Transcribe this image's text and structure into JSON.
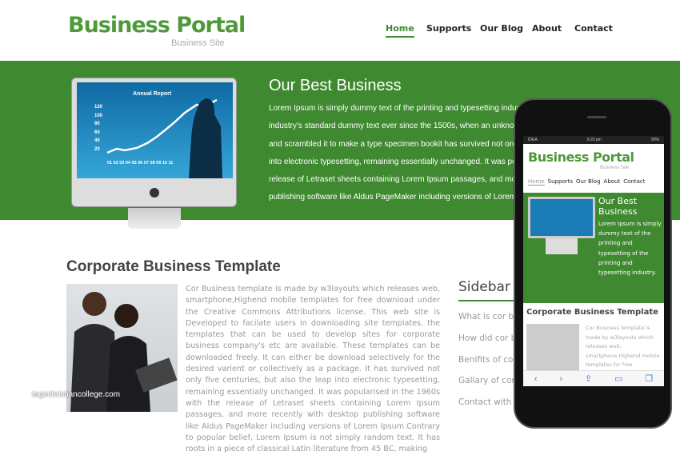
{
  "header": {
    "logo": "Business Portal",
    "tagline": "Business Site",
    "nav": [
      {
        "label": "Home",
        "active": true
      },
      {
        "label": "Supports"
      },
      {
        "label": "Our Blog"
      },
      {
        "label": "About"
      },
      {
        "label": "Contact"
      }
    ]
  },
  "hero": {
    "title": "Our Best Business",
    "lines": [
      "Lorem Ipsum is simply dummy text of the printing and typesetting industry",
      "industry's standard dummy text ever since the 1500s, when an unknown",
      "and scrambled it to make a type specimen bookit has survived not only f",
      "into electronic typesetting, remaining essentially unchanged. It was popu",
      "release of Letraset sheets containing Lorem Ipsum passages, and more",
      "publishing software like Aldus PageMaker including versions of Lorem Ip"
    ],
    "monitor": {
      "title": "Annual Report",
      "yticks": [
        "120",
        "100",
        "80",
        "60",
        "40",
        "20"
      ],
      "xticks": "01 02 03 04 05 06 07 08 09 10 11"
    }
  },
  "main": {
    "title": "Corporate Business Template",
    "paragraph": "Cor Business template is made by w3layouts which releases web, smartphone,Highend mobile templates for free download under the Creative Commons Attributions license. This web site is Developed to facilate users in downloading site templates, the templates that can be used to develop sites for corporate business company's etc are available. These templates can be downloaded freely. It can either be download selectively for the desired varient or collectively as a package. It has survived not only five centuries, but also the leap into electronic typesetting, remaining essentially unchanged. It was popularised in the 1960s with the release of Letraset sheets containing Lorem Ipsum passages, and more recently with desktop publishing software like Aldus PageMaker including versions of Lorem Ipsum.Contrary to popular belief, Lorem Ipsum is not simply random text. It has roots in a piece of classical Latin literature from 45 BC, making"
  },
  "sidebar": {
    "title": "Sidebar M",
    "items": [
      "What is cor bu",
      "How did cor be",
      "Benifits of cor",
      "Gallary of cor",
      "Contact with d"
    ]
  },
  "phone": {
    "carrier": "IDEA",
    "time": "9:20 pm",
    "battery": "90%",
    "logo": "Business Portal",
    "tagline": "Business Site",
    "nav": [
      "Home",
      "Supports",
      "Our Blog",
      "About",
      "Contact"
    ],
    "hero_title": "Our Best Business",
    "hero_text": "Lorem Ipsum is simply dummy text of the printing and typesetting of the printing and typesetting industry.",
    "section_title": "Corporate Business Template",
    "section_text": "Cor Business template is made by w3layouts which releases web, smartphone,Highend mobile templates for free"
  },
  "watermark": "tagechristiancollege.com",
  "colors": {
    "brand_green": "#3f8a30",
    "logo_green": "#4e9a3a"
  }
}
